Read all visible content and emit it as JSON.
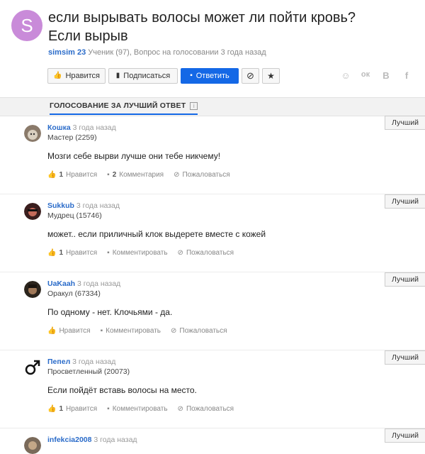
{
  "question": {
    "avatar_letter": "S",
    "title": "если вырывать волосы может ли пойти кровь? Если вырыв",
    "author": "simsim 23",
    "meta": "Ученик (97), Вопрос на голосовании 3 года назад"
  },
  "toolbar": {
    "like_label": "Нравится",
    "subscribe_label": "Подписаться",
    "reply_label": "Ответить"
  },
  "share": [
    "mail-share-icon",
    "odnoklassniki-icon",
    "vk-icon",
    "facebook-icon"
  ],
  "share_glyphs": {
    "ok": "ок",
    "vk": "В",
    "fb": "f"
  },
  "tab": {
    "label": "ГОЛОСОВАНИЕ ЗА ЛУЧШИЙ ОТВЕТ"
  },
  "best_label": "Лучший",
  "answers": [
    {
      "nick": "Кошка",
      "time": "3 года назад",
      "rank": "Мастер (2259)",
      "text": "Мозги себе вырви лучше они тебе никчему!",
      "likes_count": "1",
      "likes_label": "Нравится",
      "comments_count": "2",
      "comments_label": "Комментария",
      "report": "Пожаловаться"
    },
    {
      "nick": "Sukkub",
      "time": "3 года назад",
      "rank": "Мудрец (15746)",
      "text": "может.. если приличный клок выдерете вместе с кожей",
      "likes_count": "1",
      "likes_label": "Нравится",
      "comments_count": "",
      "comments_label": "Комментировать",
      "report": "Пожаловаться"
    },
    {
      "nick": "UaKaah",
      "time": "3 года назад",
      "rank": "Оракул (67334)",
      "text": "По одному - нет. Клочьями - да.",
      "likes_count": "",
      "likes_label": "Нравится",
      "comments_count": "",
      "comments_label": "Комментировать",
      "report": "Пожаловаться"
    },
    {
      "nick": "Пепел",
      "time": "3 года назад",
      "rank": "Просветленный (20073)",
      "text": "Если пойдёт вставь волосы на место.",
      "likes_count": "1",
      "likes_label": "Нравится",
      "comments_count": "",
      "comments_label": "Комментировать",
      "report": "Пожаловаться"
    },
    {
      "nick": "infekcia2008",
      "time": "3 года назад"
    }
  ],
  "colors": {
    "accent": "#1468e6",
    "link": "#2a6bc9",
    "avatar_q": "#c98bd9"
  }
}
